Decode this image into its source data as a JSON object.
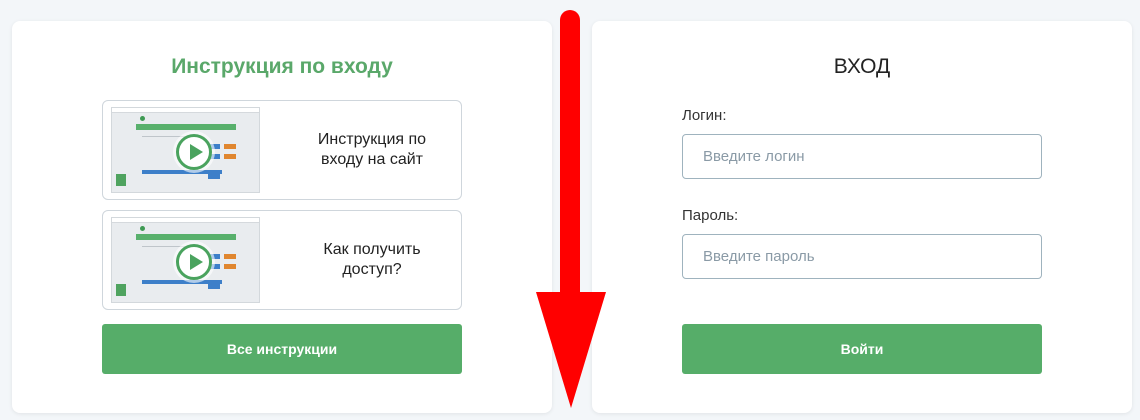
{
  "left_panel": {
    "title": "Инструкция по входу",
    "videos": [
      {
        "label": "Инструкция по входу на сайт"
      },
      {
        "label": "Как получить доступ?"
      }
    ],
    "all_button": "Все инструкции"
  },
  "right_panel": {
    "title": "ВХОД",
    "login_label": "Логин:",
    "login_placeholder": "Введите логин",
    "password_label": "Пароль:",
    "password_placeholder": "Введите пароль",
    "submit_button": "Войти"
  },
  "colors": {
    "accent_green": "#56ad69",
    "arrow_red": "#ff0000"
  },
  "icons": [
    "play-icon",
    "down-arrow-annotation"
  ]
}
